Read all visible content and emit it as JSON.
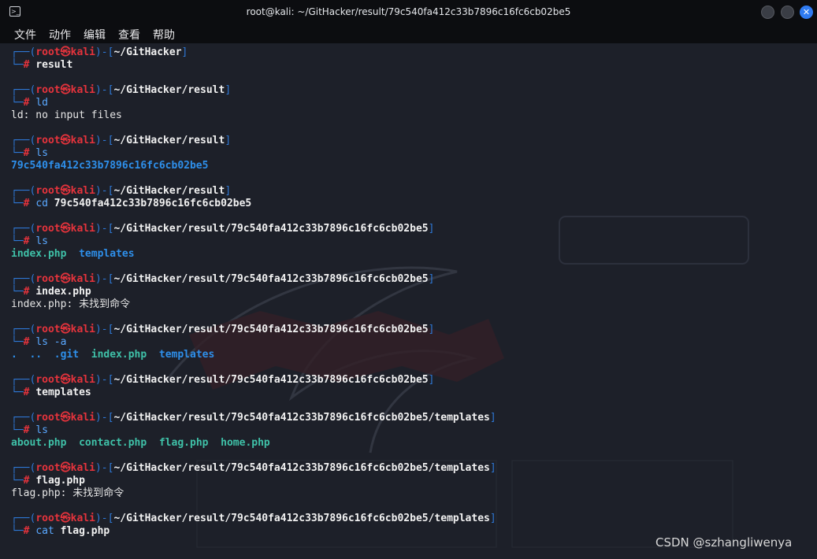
{
  "window": {
    "title": "root@kali: ~/GitHacker/result/79c540fa412c33b7896c16fc6cb02be5",
    "close_glyph": "✕",
    "app_glyph": ">_"
  },
  "menu": [
    "文件",
    "动作",
    "编辑",
    "查看",
    "帮助"
  ],
  "prompt": {
    "frame_top": "┌──(",
    "user": "root",
    "at": "㉿",
    "host": "kali",
    "mid": ")-[",
    "close": "]",
    "frame_bottom": "└─",
    "hash": "# "
  },
  "blocks": [
    {
      "path": "~/GitHacker",
      "cmd": "",
      "arg": "result",
      "output": []
    },
    {
      "path": "~/GitHacker/result",
      "cmd": "ld",
      "arg": "",
      "output": [
        [
          {
            "t": "ld: no input files",
            "c": "plain"
          }
        ]
      ]
    },
    {
      "path": "~/GitHacker/result",
      "cmd": "ls",
      "arg": "",
      "output": [
        [
          {
            "t": "79c540fa412c33b7896c16fc6cb02be5",
            "c": "dirblue"
          }
        ]
      ]
    },
    {
      "path": "~/GitHacker/result",
      "cmd": "cd",
      "arg": "79c540fa412c33b7896c16fc6cb02be5",
      "output": []
    },
    {
      "path": "~/GitHacker/result/79c540fa412c33b7896c16fc6cb02be5",
      "cmd": "ls",
      "arg": "",
      "output": [
        [
          {
            "t": "index.php",
            "c": "file-teal"
          },
          {
            "t": "  ",
            "c": "plain"
          },
          {
            "t": "templates",
            "c": "dirblue"
          }
        ]
      ]
    },
    {
      "path": "~/GitHacker/result/79c540fa412c33b7896c16fc6cb02be5",
      "cmd": "",
      "arg": "index.php",
      "output": [
        [
          {
            "t": "index.php: 未找到命令",
            "c": "plain"
          }
        ]
      ]
    },
    {
      "path": "~/GitHacker/result/79c540fa412c33b7896c16fc6cb02be5",
      "cmd": "ls -a",
      "arg": "",
      "output": [
        [
          {
            "t": ".",
            "c": "dirblue"
          },
          {
            "t": "  ",
            "c": "plain"
          },
          {
            "t": "..",
            "c": "dirblue"
          },
          {
            "t": "  ",
            "c": "plain"
          },
          {
            "t": ".git",
            "c": "dirblue"
          },
          {
            "t": "  ",
            "c": "plain"
          },
          {
            "t": "index.php",
            "c": "file-teal"
          },
          {
            "t": "  ",
            "c": "plain"
          },
          {
            "t": "templates",
            "c": "dirblue"
          }
        ]
      ]
    },
    {
      "path": "~/GitHacker/result/79c540fa412c33b7896c16fc6cb02be5",
      "cmd": "",
      "arg": "templates",
      "output": []
    },
    {
      "path": "~/GitHacker/result/79c540fa412c33b7896c16fc6cb02be5/templates",
      "cmd": "ls",
      "arg": "",
      "output": [
        [
          {
            "t": "about.php",
            "c": "file-teal"
          },
          {
            "t": "  ",
            "c": "plain"
          },
          {
            "t": "contact.php",
            "c": "file-teal"
          },
          {
            "t": "  ",
            "c": "plain"
          },
          {
            "t": "flag.php",
            "c": "file-teal"
          },
          {
            "t": "  ",
            "c": "plain"
          },
          {
            "t": "home.php",
            "c": "file-teal"
          }
        ]
      ]
    },
    {
      "path": "~/GitHacker/result/79c540fa412c33b7896c16fc6cb02be5/templates",
      "cmd": "",
      "arg": "flag.php",
      "output": [
        [
          {
            "t": "flag.php: 未找到命令",
            "c": "plain"
          }
        ]
      ]
    },
    {
      "path": "~/GitHacker/result/79c540fa412c33b7896c16fc6cb02be5/templates",
      "cmd": "cat",
      "arg": "flag.php",
      "output": []
    }
  ],
  "watermark_text": "CSDN @szhangliwenya"
}
